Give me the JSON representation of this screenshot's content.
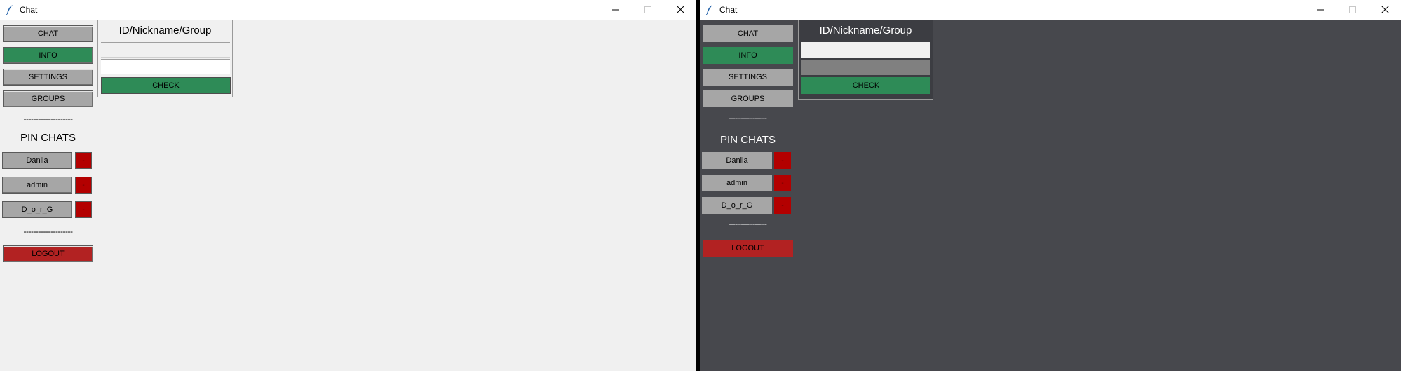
{
  "window_title": "Chat",
  "menu": {
    "chat": "CHAT",
    "info": "INFO",
    "settings": "SETTINGS",
    "groups": "GROUPS",
    "logout": "LOGOUT"
  },
  "separator_light": "--------------------",
  "separator_dark": "-------------------",
  "pin_title": "PIN CHATS",
  "pins": [
    {
      "name": "Danila",
      "remove": "-"
    },
    {
      "name": "admin",
      "remove": "-"
    },
    {
      "name": "D_o_r_G",
      "remove": "-"
    }
  ],
  "lookup": {
    "title": "ID/Nickname/Group",
    "field1_value": "",
    "field2_value": "",
    "check_label": "CHECK"
  },
  "colors": {
    "light_bg": "#f0f0f0",
    "dark_bg": "#47484d",
    "button_gray": "#a6a6a6",
    "accent_green": "#2e8b57",
    "danger_red": "#b22222"
  },
  "icons": {
    "app": "feather-icon",
    "minimize": "minimize-icon",
    "maximize": "maximize-icon",
    "close": "close-icon"
  }
}
